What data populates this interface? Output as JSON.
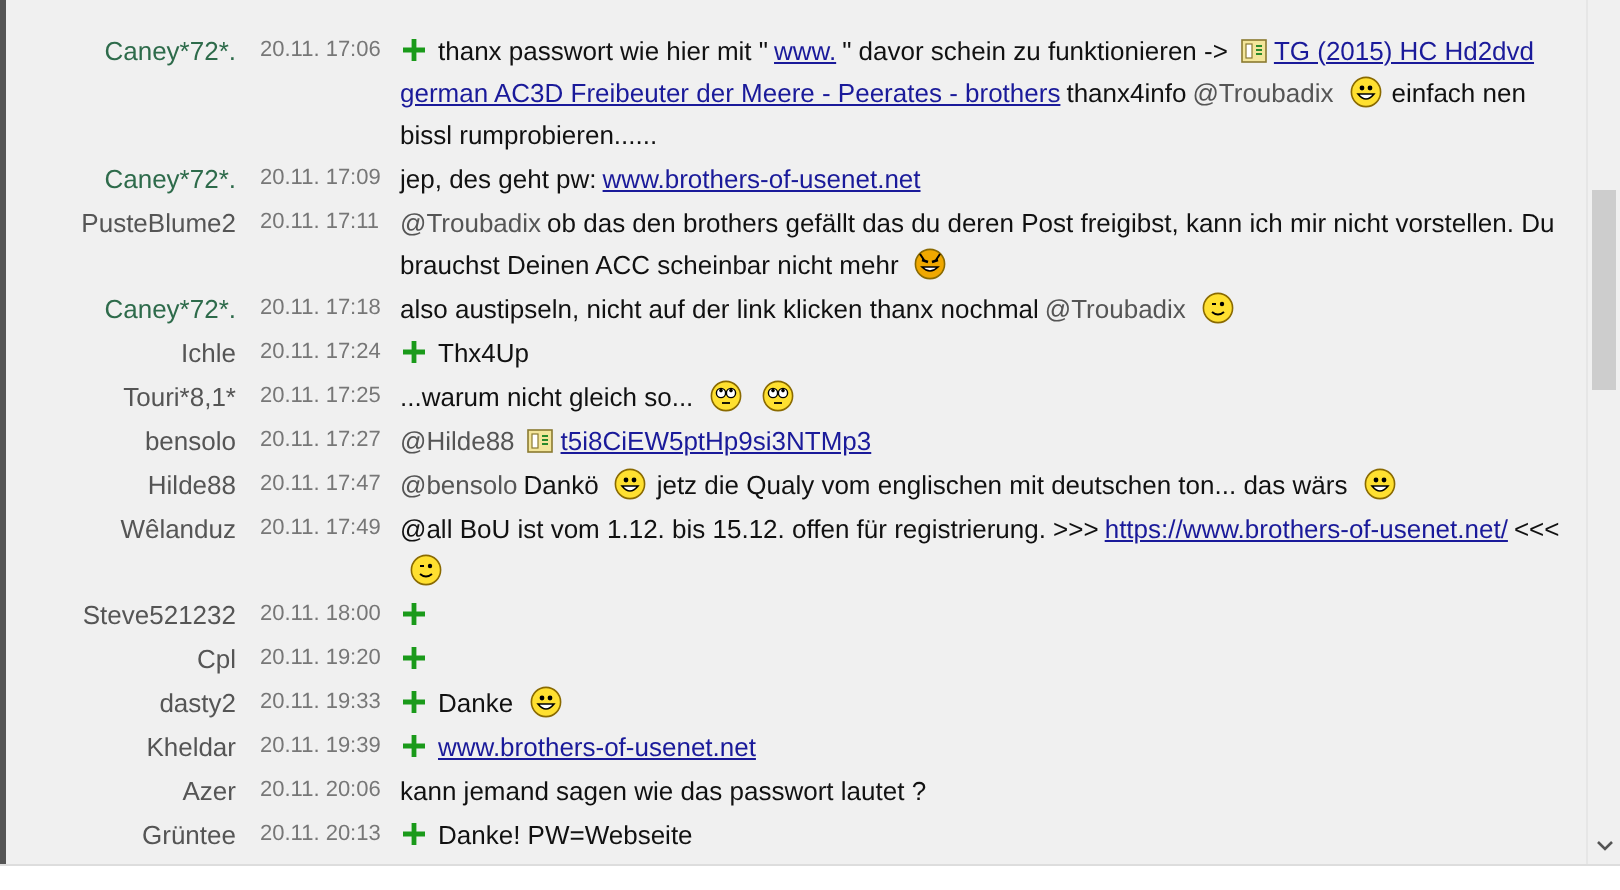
{
  "messages": [
    {
      "author": "Caney*72*.",
      "color": "#2e6b4b",
      "time": "20.11. 17:06",
      "parts": [
        {
          "kind": "plus"
        },
        {
          "kind": "text",
          "text": "thanx passwort wie hier mit \""
        },
        {
          "kind": "link",
          "text": "www."
        },
        {
          "kind": "text",
          "text": "\" davor schein zu funktionieren ->"
        },
        {
          "kind": "file"
        },
        {
          "kind": "link",
          "text": "TG (2015) HC Hd2dvd"
        },
        {
          "kind": "link",
          "text": "german AC3D Freibeuter der Meere - Peerates - brothers"
        },
        {
          "kind": "text",
          "text": "thanx4info"
        },
        {
          "kind": "mention",
          "text": "@Troubadix"
        },
        {
          "kind": "grin"
        },
        {
          "kind": "text",
          "text": "einfach nen bissl rumprobieren......"
        }
      ]
    },
    {
      "author": "Caney*72*.",
      "color": "#2e6b4b",
      "time": "20.11. 17:09",
      "parts": [
        {
          "kind": "text",
          "text": "jep, des geht pw:"
        },
        {
          "kind": "link",
          "text": "www.brothers-of-usenet.net"
        }
      ]
    },
    {
      "author": "PusteBlume2",
      "color": "#555555",
      "time": "20.11. 17:11",
      "parts": [
        {
          "kind": "mention",
          "text": "@Troubadix"
        },
        {
          "kind": "text",
          "text": "ob das den brothers gefällt das du deren Post freigibst, kann ich mir nicht vorstellen. Du brauchst Deinen ACC scheinbar nicht mehr"
        },
        {
          "kind": "devil"
        }
      ]
    },
    {
      "author": "Caney*72*.",
      "color": "#2e6b4b",
      "time": "20.11. 17:18",
      "parts": [
        {
          "kind": "text",
          "text": "also austipseln, nicht auf der link klicken thanx nochmal"
        },
        {
          "kind": "mention",
          "text": "@Troubadix"
        },
        {
          "kind": "wink"
        }
      ]
    },
    {
      "author": "Ichle",
      "color": "#555555",
      "time": "20.11. 17:24",
      "parts": [
        {
          "kind": "plus"
        },
        {
          "kind": "text",
          "text": "Thx4Up"
        }
      ]
    },
    {
      "author": "Touri*8,1*",
      "color": "#555555",
      "time": "20.11. 17:25",
      "parts": [
        {
          "kind": "text",
          "text": "...warum nicht gleich so..."
        },
        {
          "kind": "rolleyes"
        },
        {
          "kind": "rolleyes"
        }
      ]
    },
    {
      "author": "bensolo",
      "color": "#555555",
      "time": "20.11. 17:27",
      "parts": [
        {
          "kind": "mention",
          "text": "@Hilde88"
        },
        {
          "kind": "file"
        },
        {
          "kind": "link",
          "text": "t5i8CiEW5ptHp9si3NTMp3"
        }
      ]
    },
    {
      "author": "Hilde88",
      "color": "#555555",
      "time": "20.11. 17:47",
      "parts": [
        {
          "kind": "mention",
          "text": "@bensolo"
        },
        {
          "kind": "text",
          "text": "Dankö"
        },
        {
          "kind": "grin"
        },
        {
          "kind": "text",
          "text": "jetz die Qualy vom englischen mit deutschen ton... das wärs"
        },
        {
          "kind": "grin"
        }
      ]
    },
    {
      "author": "Wêlanduz",
      "color": "#555555",
      "time": "20.11. 17:49",
      "parts": [
        {
          "kind": "text",
          "text": "@all BoU ist vom 1.12.  bis 15.12.  offen für registrierung. >>>"
        },
        {
          "kind": "link",
          "text": "https://www.brothers-of-usenet.net/"
        },
        {
          "kind": "text",
          "text": "<<<"
        },
        {
          "kind": "wink"
        }
      ]
    },
    {
      "author": "Steve521232",
      "color": "#555555",
      "time": "20.11. 18:00",
      "parts": [
        {
          "kind": "plus"
        }
      ]
    },
    {
      "author": "Cpl",
      "color": "#555555",
      "time": "20.11. 19:20",
      "parts": [
        {
          "kind": "plus"
        }
      ]
    },
    {
      "author": "dasty2",
      "color": "#555555",
      "time": "20.11. 19:33",
      "parts": [
        {
          "kind": "plus"
        },
        {
          "kind": "text",
          "text": "Danke"
        },
        {
          "kind": "grin"
        }
      ]
    },
    {
      "author": "Kheldar",
      "color": "#555555",
      "time": "20.11. 19:39",
      "parts": [
        {
          "kind": "plus"
        },
        {
          "kind": "link",
          "text": "www.brothers-of-usenet.net"
        }
      ]
    },
    {
      "author": "Azer",
      "color": "#555555",
      "time": "20.11. 20:06",
      "parts": [
        {
          "kind": "text",
          "text": "kann jemand sagen wie das passwort lautet ?"
        }
      ]
    },
    {
      "author": "Grüntee",
      "color": "#555555",
      "time": "20.11. 20:13",
      "parts": [
        {
          "kind": "plus"
        },
        {
          "kind": "text",
          "text": "Danke! PW=Webseite"
        }
      ]
    }
  ]
}
